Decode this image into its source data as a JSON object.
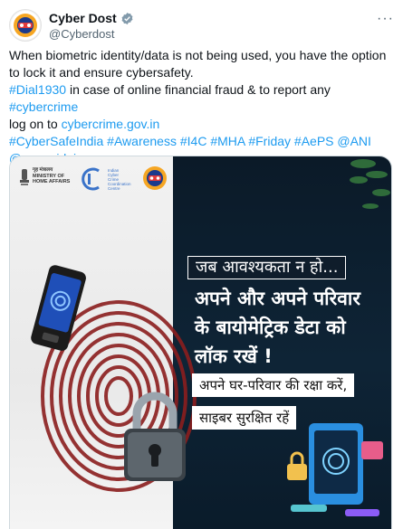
{
  "tweet": {
    "author_name": "Cyber Dost",
    "author_handle": "@Cyberdost",
    "more_glyph": "···",
    "text_line1": "When biometric identity/data is not being used, you have the option to lock it and ensure cybersafety.",
    "hashtag_dial": "#Dial1930",
    "text_mid1": " in case of online financial fraud & to report any ",
    "hashtag_cybercrime": "#cybercrime",
    "text_mid2": "log on to ",
    "link_portal": "cybercrime.gov.in",
    "hashtags_line": "#CyberSafeIndia #Awareness #I4C #MHA #Friday #AePS @ANI",
    "mention_uidai": "@ceo_uidai"
  },
  "poster": {
    "mha_lines": [
      "गृह मंत्रालय",
      "MINISTRY OF",
      "HOME AFFAIRS"
    ],
    "i4c_lines": [
      "Indian",
      "Cyber",
      "Crime",
      "Coordination",
      "Centre"
    ],
    "banner_top": "जब आवश्यकता न हो...",
    "headline_line1": "अपने और अपने परिवार",
    "headline_line2": "के बायोमेट्रिक डेटा को",
    "headline_line3": "लॉक रखें !",
    "pill_line1": "अपने घर-परिवार की रक्षा करें,",
    "pill_line2": "साइबर सुरक्षित रहें"
  },
  "icons": {
    "verified": "verified-badge-icon",
    "more": "more-options-icon",
    "fingerprint": "fingerprint-icon",
    "phone": "phone-icon",
    "padlock": "padlock-icon"
  },
  "colors": {
    "link": "#1d9bf0",
    "poster_dark": "#0b1a28",
    "fingerprint": "#8b1e1e"
  }
}
